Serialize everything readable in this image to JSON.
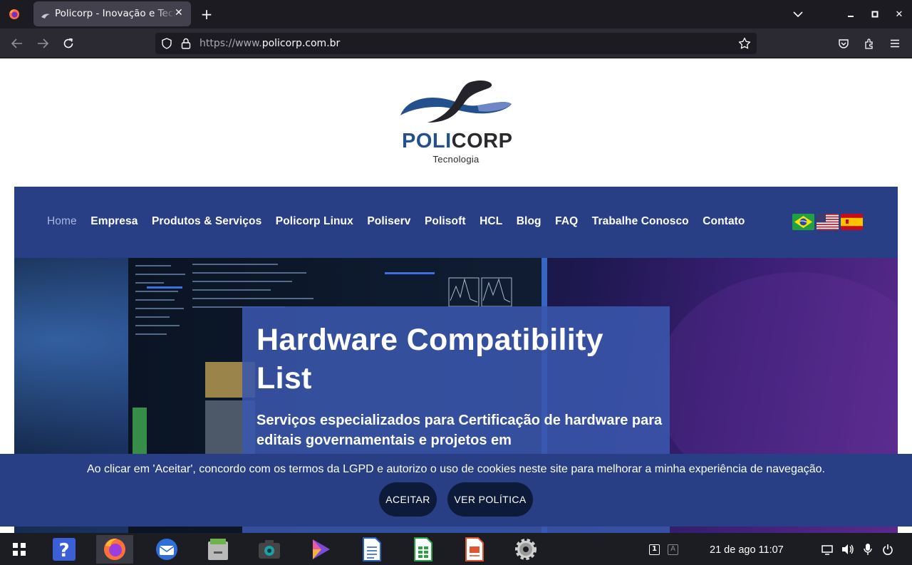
{
  "browser": {
    "tab_title": "Policorp - Inovação e Tecnologia",
    "url_prefix": "https://www.",
    "url_domain": "policorp.com.br"
  },
  "logo": {
    "name_part1": "POLI",
    "name_part2": "CORP",
    "tagline": "Tecnologia"
  },
  "nav": {
    "items": [
      "Home",
      "Empresa",
      "Produtos & Serviços",
      "Policorp Linux",
      "Poliserv",
      "Polisoft",
      "HCL",
      "Blog",
      "FAQ",
      "Trabalhe Conosco",
      "Contato"
    ],
    "flags": [
      "brazil-flag-icon",
      "usa-flag-icon",
      "spain-flag-icon"
    ]
  },
  "hero": {
    "title": "Hardware Compatibility List",
    "subtitle": "Serviços especializados para Certificação de hardware para editais governamentais e projetos em"
  },
  "cookie_banner": {
    "text": "Ao clicar em 'Aceitar', concordo com os termos da LGPD e autorizo o uso de cookies neste site para melhorar a minha experiência de navegação.",
    "accept_label": "ACEITAR",
    "policy_label": "VER POLÍTICA"
  },
  "taskbar": {
    "apps": [
      "app-grid-icon",
      "help-icon",
      "firefox-icon",
      "thunderbird-icon",
      "files-icon",
      "camera-icon",
      "media-player-icon",
      "writer-icon",
      "calc-icon",
      "impress-icon",
      "settings-icon"
    ],
    "workspace_1": "1",
    "workspace_2": "A",
    "clock": "21 de ago  11:07"
  },
  "colors": {
    "nav_bg": "#283f86",
    "brand_blue": "#24508e",
    "button_dark": "#0d1a3a"
  }
}
